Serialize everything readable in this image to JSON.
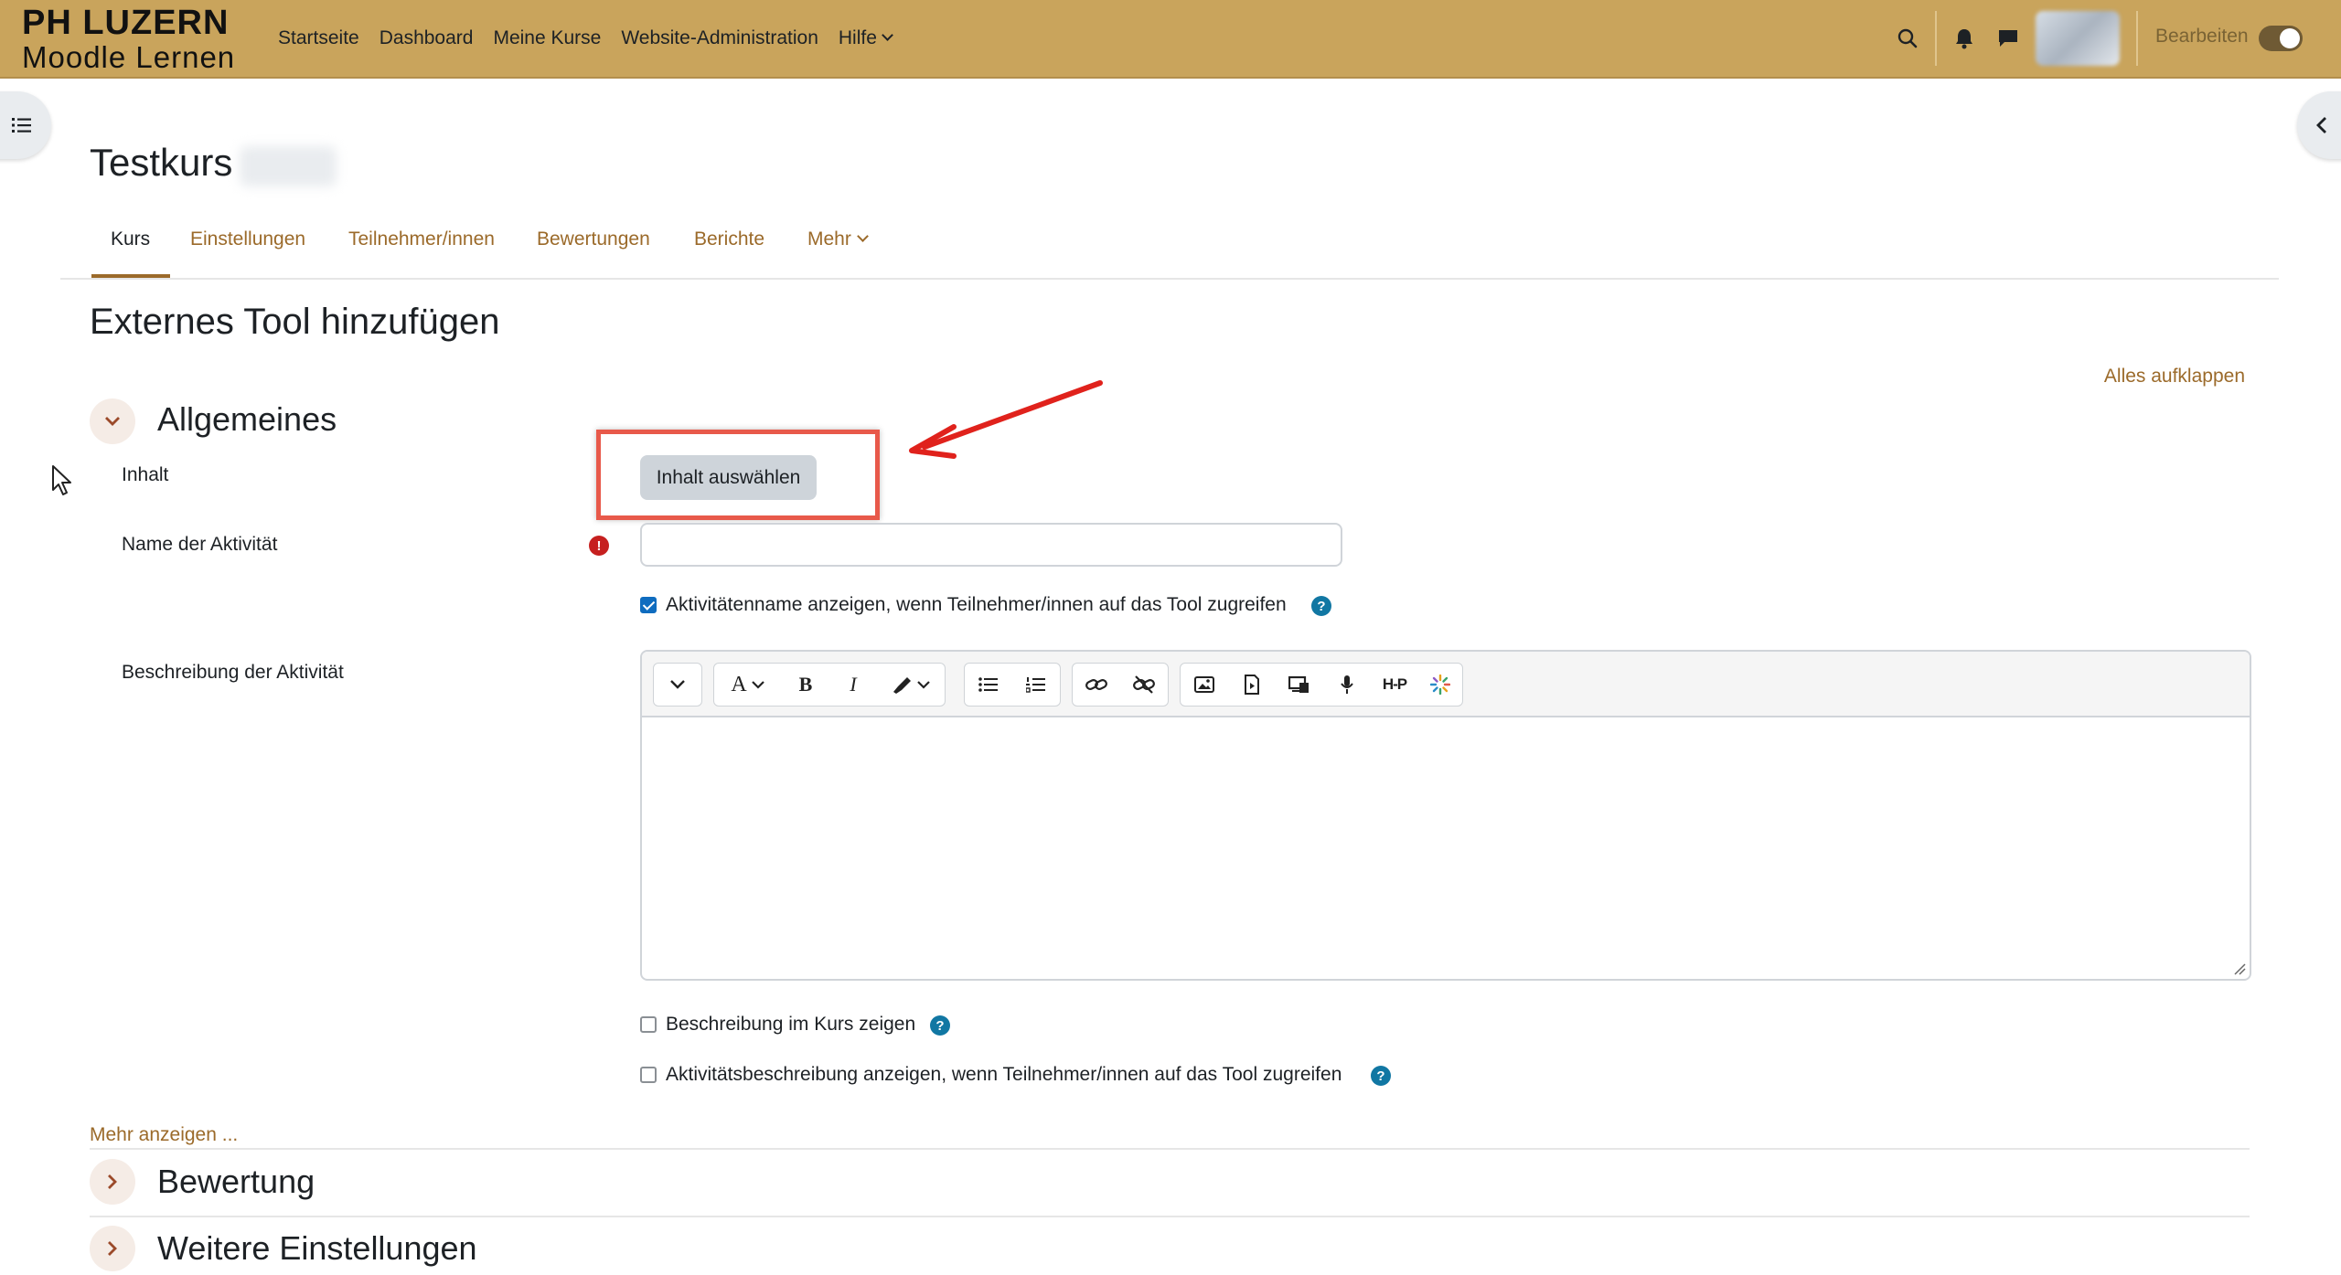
{
  "navbar": {
    "logo_line1": "PH LUZERN",
    "logo_line2": "Moodle Lernen",
    "links": [
      "Startseite",
      "Dashboard",
      "Meine Kurse",
      "Website-Administration",
      "Hilfe"
    ],
    "edit_mode_label": "Bearbeiten",
    "edit_mode_on": true,
    "icons": [
      "search-icon",
      "bell-icon",
      "chat-icon",
      "user-avatar",
      "toggle"
    ]
  },
  "course": {
    "title": "Testkurs"
  },
  "tabs": [
    "Kurs",
    "Einstellungen",
    "Teilnehmer/innen",
    "Bewertungen",
    "Berichte",
    "Mehr"
  ],
  "active_tab": "Kurs",
  "page": {
    "heading": "Externes Tool hinzufügen",
    "expand_all": "Alles aufklappen"
  },
  "sections": {
    "general": "Allgemeines",
    "grading": "Bewertung",
    "more_settings": "Weitere Einstellungen"
  },
  "form": {
    "content_label": "Inhalt",
    "content_button": "Inhalt auswählen",
    "name_label": "Name der Aktivität",
    "name_value": "",
    "show_name_checkbox": "Aktivitätenname anzeigen, wenn Teilnehmer/innen auf das Tool zugreifen",
    "show_name_checked": true,
    "description_label": "Beschreibung der Aktivität",
    "show_desc_course": "Beschreibung im Kurs zeigen",
    "show_desc_course_checked": false,
    "show_desc_tool": "Aktivitätsbeschreibung anzeigen, wenn Teilnehmer/innen auf das Tool zugreifen",
    "show_desc_tool_checked": false,
    "more_link": "Mehr anzeigen ..."
  },
  "editor_toolbar": {
    "buttons": [
      "collapse-icon",
      "font-color-icon",
      "bold-icon",
      "italic-icon",
      "highlight-icon",
      "bullet-list-icon",
      "numbered-list-icon",
      "link-icon",
      "unlink-icon",
      "image-icon",
      "media-icon",
      "manage-files-icon",
      "record-audio-icon",
      "h5p-icon",
      "ai-icon"
    ],
    "bold_glyph": "B",
    "italic_glyph": "I",
    "font_glyph": "A",
    "h5p_glyph": "H-P"
  },
  "colors": {
    "navbar": "#c9a45c",
    "link": "#9b6a2a",
    "annotation": "#e8594a",
    "required": "#c6201f",
    "help": "#1177a3",
    "checkbox": "#0f6cbf"
  }
}
